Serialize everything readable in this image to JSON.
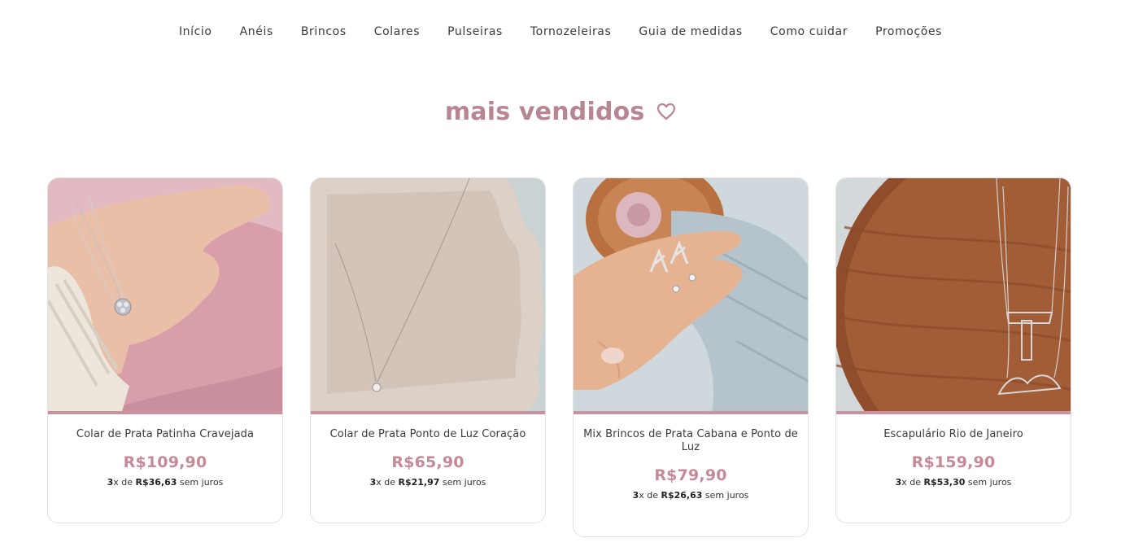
{
  "nav": {
    "items": [
      "Início",
      "Anéis",
      "Brincos",
      "Colares",
      "Pulseiras",
      "Tornozeleiras",
      "Guia de medidas",
      "Como cuidar",
      "Promoções"
    ]
  },
  "section": {
    "title": "mais vendidos",
    "icon": "heart-outline-icon"
  },
  "products": [
    {
      "name": "Colar de Prata Patinha Cravejada",
      "price": "R$109,90",
      "inst_count": "3",
      "inst_x": "x de",
      "inst_value": "R$36,63",
      "inst_suffix": "sem juros"
    },
    {
      "name": "Colar de Prata Ponto de Luz Coração",
      "price": "R$65,90",
      "inst_count": "3",
      "inst_x": "x de",
      "inst_value": "R$21,97",
      "inst_suffix": "sem juros"
    },
    {
      "name": "Mix Brincos de Prata Cabana e Ponto de Luz",
      "price": "R$79,90",
      "inst_count": "3",
      "inst_x": "x de",
      "inst_value": "R$26,63",
      "inst_suffix": "sem juros"
    },
    {
      "name": "Escapulário Rio de Janeiro",
      "price": "R$159,90",
      "inst_count": "3",
      "inst_x": "x de",
      "inst_value": "R$53,30",
      "inst_suffix": "sem juros"
    }
  ],
  "colors": {
    "accent": "#c58a98",
    "title": "#b88592",
    "photo_border": "#c8939e"
  }
}
